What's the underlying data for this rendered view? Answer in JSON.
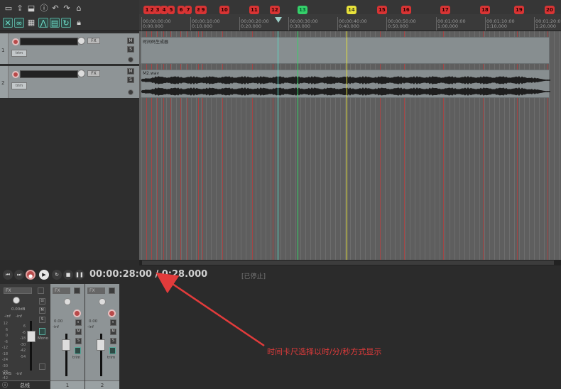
{
  "toolbar": {
    "row1_icons": [
      "new-project-icon",
      "open-project-icon",
      "save-project-icon",
      "project-settings-icon",
      "undo-icon",
      "redo-icon",
      "metronome-icon"
    ],
    "row2_icons": [
      "grid-snap-icon",
      "ripple-edit-icon",
      "item-grouping-icon",
      "auto-crossfade-icon",
      "envelope-lock-icon",
      "loop-points-icon",
      "global-lock-icon"
    ]
  },
  "ruler": {
    "markers": [
      {
        "label": "1",
        "color": "red"
      },
      {
        "label": "2",
        "color": "red"
      },
      {
        "label": "3",
        "color": "red"
      },
      {
        "label": "4",
        "color": "red"
      },
      {
        "label": "5",
        "color": "red"
      },
      {
        "label": "6",
        "color": "red"
      },
      {
        "label": "7",
        "color": "red"
      },
      {
        "label": "8",
        "color": "red"
      },
      {
        "label": "9",
        "color": "red"
      },
      {
        "label": "10",
        "color": "red"
      },
      {
        "label": "11",
        "color": "red"
      },
      {
        "label": "12",
        "color": "red"
      },
      {
        "label": "13",
        "color": "green"
      },
      {
        "label": "14",
        "color": "yellow"
      },
      {
        "label": "15",
        "color": "red"
      },
      {
        "label": "16",
        "color": "red"
      },
      {
        "label": "17",
        "color": "red"
      },
      {
        "label": "18",
        "color": "red"
      },
      {
        "label": "19",
        "color": "red"
      },
      {
        "label": "20",
        "color": "red"
      }
    ],
    "ticks": [
      {
        "top": "00:00:00:00",
        "bottom": "0:00.000"
      },
      {
        "top": "00:00:10:00",
        "bottom": "0:10.000"
      },
      {
        "top": "00:00:20:00",
        "bottom": "0:20.000"
      },
      {
        "top": "00:00:30:00",
        "bottom": "0:30.000"
      },
      {
        "top": "00:00:40:00",
        "bottom": "0:40.000"
      },
      {
        "top": "00:00:50:00",
        "bottom": "0:50.000"
      },
      {
        "top": "00:01:00:00",
        "bottom": "1:00.000"
      },
      {
        "top": "00:01:10:00",
        "bottom": "1:10.000"
      },
      {
        "top": "00:01:20:00",
        "bottom": "1:20.000"
      }
    ]
  },
  "tracks": [
    {
      "number": "1",
      "item_name": "时间码生成器",
      "fx_label": "FX",
      "env_label": "trim",
      "m_label": "M",
      "s_label": "S"
    },
    {
      "number": "2",
      "item_name": "M2.wav",
      "fx_label": "FX",
      "env_label": "trim",
      "m_label": "M",
      "s_label": "S"
    }
  ],
  "transport": {
    "timecode": "00:00:28:00 / 0:28.000",
    "status": "[已停止]"
  },
  "mixer": {
    "master": {
      "footer": "总线",
      "fx": "FX",
      "vol": "0.00dB",
      "left_peak": "-inf",
      "right_peak": "-inf",
      "rms_label": "RMS",
      "rms_value": "-inf",
      "mono_label": "Mono",
      "info_icon": "info-icon"
    },
    "strips": [
      {
        "footer": "1",
        "fx": "FX",
        "vol": "0.00",
        "peak": "-inf",
        "trim": "trim"
      },
      {
        "footer": "2",
        "fx": "FX",
        "vol": "0.00",
        "peak": "-inf",
        "trim": "trim"
      }
    ],
    "scale": [
      "12",
      "6",
      "0",
      "-6",
      "-12",
      "-18",
      "-24",
      "-30",
      "-36",
      "-42",
      "-48",
      "-54"
    ],
    "scale_inner": [
      "6",
      "-6",
      "-18",
      "-30",
      "-42",
      "-54"
    ]
  },
  "annotation": {
    "text": "时间卡尺选择以时/分/秒方式显示",
    "color": "#e23b3b"
  },
  "colors": {
    "marker_red": "#d83434",
    "marker_green": "#35d06a",
    "marker_yellow": "#e8e23a",
    "track_bg": "#8e9496",
    "arrange_bg": "#5e5e5e"
  }
}
